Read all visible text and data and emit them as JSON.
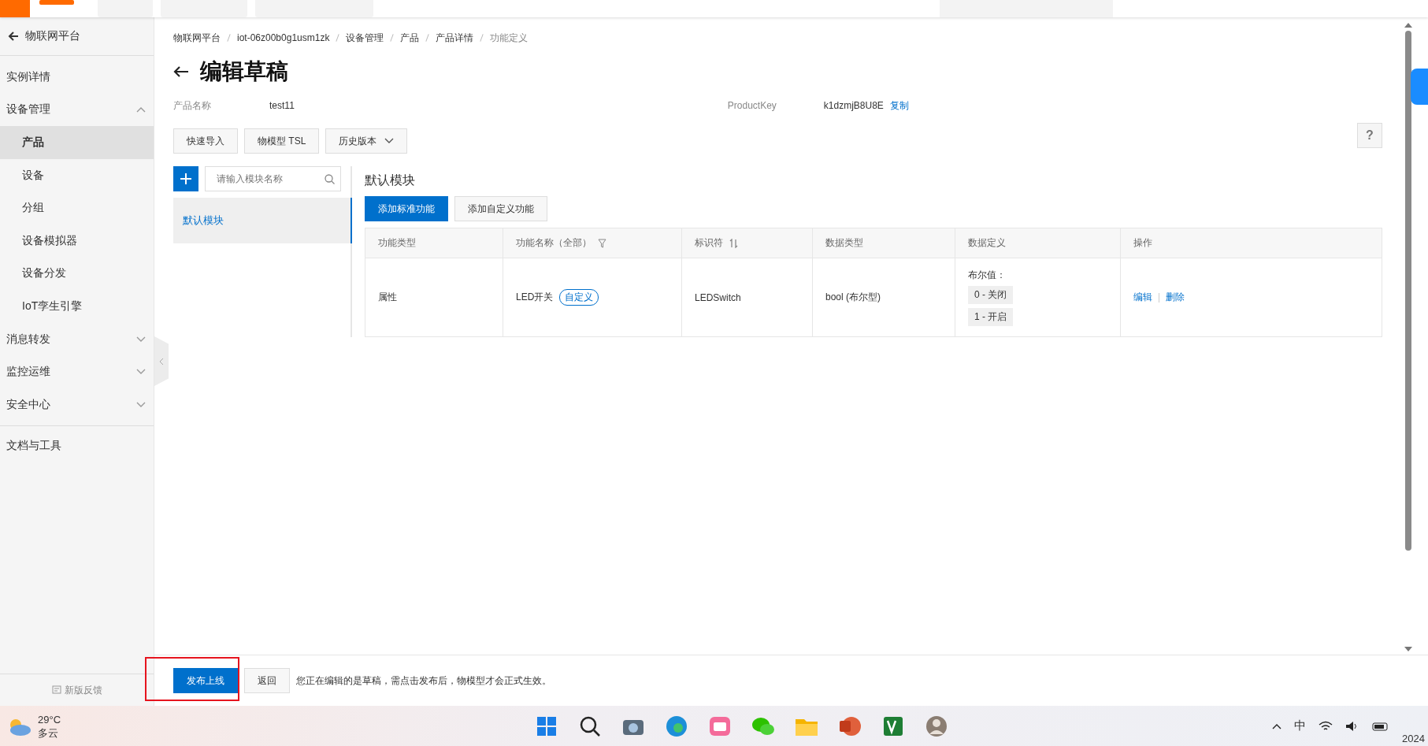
{
  "sidebar": {
    "back_label": "物联网平台",
    "items": [
      {
        "label": "实例详情",
        "kind": "link",
        "selected": false
      },
      {
        "label": "设备管理",
        "kind": "group",
        "expanded": true,
        "selected": false,
        "children": [
          {
            "label": "产品",
            "selected": true
          },
          {
            "label": "设备",
            "selected": false
          },
          {
            "label": "分组",
            "selected": false
          },
          {
            "label": "设备模拟器",
            "selected": false
          },
          {
            "label": "设备分发",
            "selected": false
          },
          {
            "label": "IoT孪生引擎",
            "selected": false
          }
        ]
      },
      {
        "label": "消息转发",
        "kind": "group",
        "expanded": false,
        "selected": false
      },
      {
        "label": "监控运维",
        "kind": "group",
        "expanded": false,
        "selected": false
      },
      {
        "label": "安全中心",
        "kind": "group",
        "expanded": false,
        "selected": false
      },
      {
        "label": "文档与工具",
        "kind": "section",
        "selected": false
      }
    ],
    "feedback": "新版反馈"
  },
  "breadcrumb": [
    "物联网平台",
    "iot-06z00b0g1usm1zk",
    "设备管理",
    "产品",
    "产品详情",
    "功能定义"
  ],
  "title": "编辑草稿",
  "product": {
    "name_label": "产品名称",
    "name": "test11",
    "key_label": "ProductKey",
    "key": "k1dzmjB8U8E",
    "copy": "复制"
  },
  "toolbar": [
    {
      "label": "快速导入",
      "kind": "button"
    },
    {
      "label": "物模型 TSL",
      "kind": "button"
    },
    {
      "label": "历史版本",
      "kind": "dropdown"
    }
  ],
  "modules": {
    "search_placeholder": "请输入模块名称",
    "items": [
      {
        "label": "默认模块",
        "selected": true
      }
    ]
  },
  "module_title": "默认模块",
  "actions": [
    {
      "label": "添加标准功能",
      "primary": true
    },
    {
      "label": "添加自定义功能",
      "primary": false
    }
  ],
  "help": "?",
  "table": {
    "columns": [
      {
        "label": "功能类型",
        "kind": "plain"
      },
      {
        "label": "功能名称（全部）",
        "kind": "filter"
      },
      {
        "label": "标识符",
        "kind": "sort"
      },
      {
        "label": "数据类型",
        "kind": "plain"
      },
      {
        "label": "数据定义",
        "kind": "plain"
      },
      {
        "label": "操作",
        "kind": "plain"
      }
    ],
    "rows": [
      {
        "type": "属性",
        "name": "LED开关",
        "tag": "自定义",
        "identifier": "LEDSwitch",
        "data_type": "bool (布尔型)",
        "definition": {
          "title": "布尔值：",
          "values": [
            "0 - 关闭",
            "1 - 开启"
          ]
        },
        "operations": [
          "编辑",
          "删除"
        ]
      }
    ]
  },
  "footer": {
    "buttons": [
      {
        "label": "发布上线",
        "primary": true,
        "highlighted": true
      },
      {
        "label": "返回",
        "primary": false,
        "highlighted": false
      }
    ],
    "note": "您正在编辑的是草稿，需点击发布后，物模型才会正式生效。"
  },
  "taskbar": {
    "weather": {
      "temp": "29°C",
      "text": "多云"
    },
    "ime": "中",
    "clock": "2024"
  }
}
